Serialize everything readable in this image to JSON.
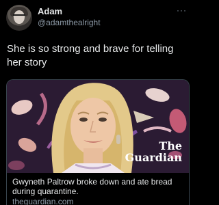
{
  "user": {
    "display_name": "Adam",
    "handle": "@adamthealright"
  },
  "more_label": "···",
  "tweet": {
    "text": "She is so strong and brave for telling her story"
  },
  "card": {
    "logo_line1": "The",
    "logo_line2": "Guardian",
    "title": "Gwyneth Paltrow broke down and ate bread during quarantine.",
    "domain": "theguardian.com"
  },
  "colors": {
    "background": "#000000",
    "text_primary": "#e7e9ea",
    "text_secondary": "#8b98a5",
    "card_border": "#38444d"
  }
}
